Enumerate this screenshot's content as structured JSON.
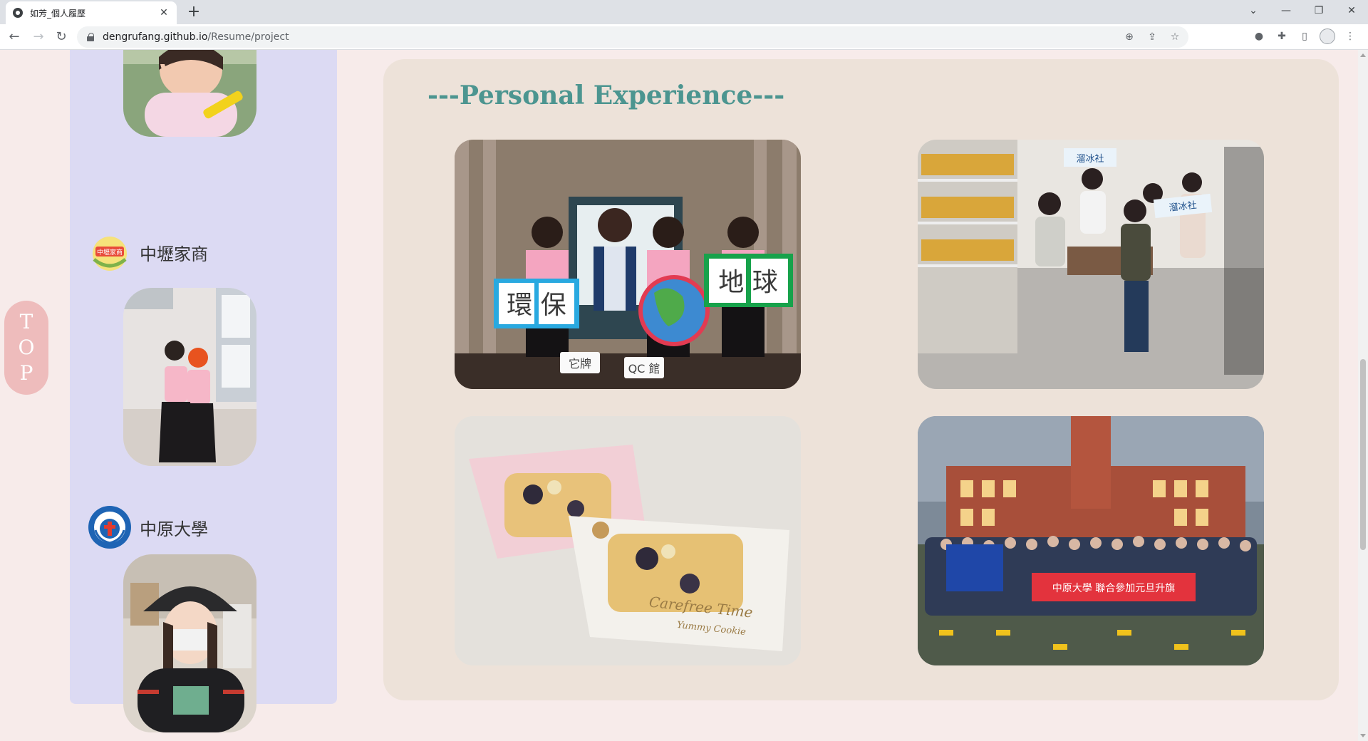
{
  "browser": {
    "tab_title": "如芳_個人履歷",
    "url_host": "dengrufang.github.io",
    "url_path": "/Resume/project",
    "new_tab_symbol": "+",
    "close_symbol": "✕"
  },
  "sidebar": {
    "schools": [
      {
        "name": "中壢家商",
        "logo_text": "中壢家商"
      },
      {
        "name": "中原大學"
      }
    ]
  },
  "top_button": {
    "letters": [
      "T",
      "O",
      "P"
    ]
  },
  "main": {
    "title": "---Personal Experience---",
    "photo_texts": {
      "sign_left": "環 保",
      "sign_right": "地 球",
      "placard_1": "它牌",
      "placard_2": "QC 館",
      "banner_1": "溜冰社",
      "banner_2": "溜冰社",
      "cookie_brand": "Carefree Time",
      "cookie_sub": "Yummy Cookie",
      "group_banner": "中原大學 聯合參加元旦升旗"
    }
  },
  "colors": {
    "page_bg": "#f7ebea",
    "sidebar_bg": "#dcdaf3",
    "card_bg": "#ede2d9",
    "title_color": "#4c9590",
    "top_button_bg": "#eebcbc"
  },
  "icons": [
    "back-icon",
    "forward-icon",
    "reload-icon",
    "lock-icon",
    "zoom-icon",
    "share-icon",
    "star-icon",
    "extension-icon",
    "puzzle-icon",
    "sidepanel-icon",
    "profile-icon",
    "menu-icon"
  ]
}
